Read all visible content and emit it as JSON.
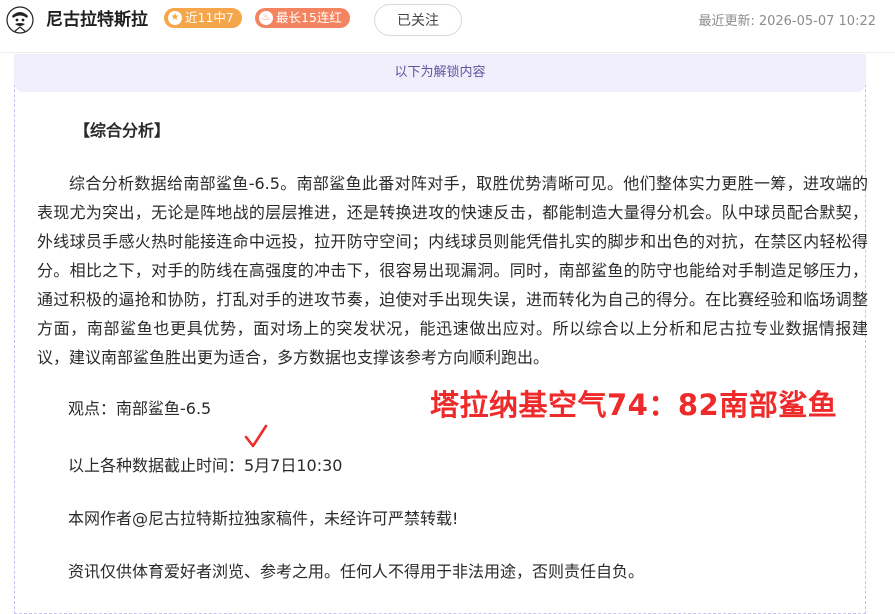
{
  "header": {
    "author_name": "尼古拉特斯拉",
    "badge_streak": "近11中7",
    "badge_longest": "最长15连红",
    "follow_label": "已关注",
    "updated_label": "最近更新:",
    "updated_time": "2026-05-07 10:22"
  },
  "unlock_banner": "以下为解锁内容",
  "article": {
    "section_title": "【综合分析】",
    "paragraph": "综合分析数据给南部鲨鱼-6.5。南部鲨鱼此番对阵对手，取胜优势清晰可见。他们整体实力更胜一筹，进攻端的表现尤为突出，无论是阵地战的层层推进，还是转换进攻的快速反击，都能制造大量得分机会。队中球员配合默契，外线球员手感火热时能接连命中远投，拉开防守空间；内线球员则能凭借扎实的脚步和出色的对抗，在禁区内轻松得分。相比之下，对手的防线在高强度的冲击下，很容易出现漏洞。同时，南部鲨鱼的防守也能给对手制造足够压力，通过积极的逼抢和协防，打乱对手的进攻节奏，迫使对手出现失误，进而转化为自己的得分。在比赛经验和临场调整方面，南部鲨鱼也更具优势，面对场上的突发状况，能迅速做出应对。所以综合以上分析和尼古拉专业数据情报建议，建议南部鲨鱼胜出更为适合，多方数据也支撑该参考方向顺利跑出。",
    "viewpoint": "观点：南部鲨鱼-6.5",
    "cutoff": "以上各种数据截止时间：5月7日10:30",
    "copyright": "本网作者@尼古拉特斯拉独家稿件，未经许可严禁转载!",
    "disclaimer": "资讯仅供体育爱好者浏览、参考之用。任何人不得用于非法用途，否则责任自负。"
  },
  "overlay": {
    "result_text": "塔拉纳基空气74：82南部鲨鱼",
    "result_color": "#ee2a2a",
    "check_icon": "checkmark-icon"
  },
  "colors": {
    "badge_streak": "#f5a54a",
    "badge_longest": "#f4845f",
    "banner_bg": "#f1eefc"
  }
}
